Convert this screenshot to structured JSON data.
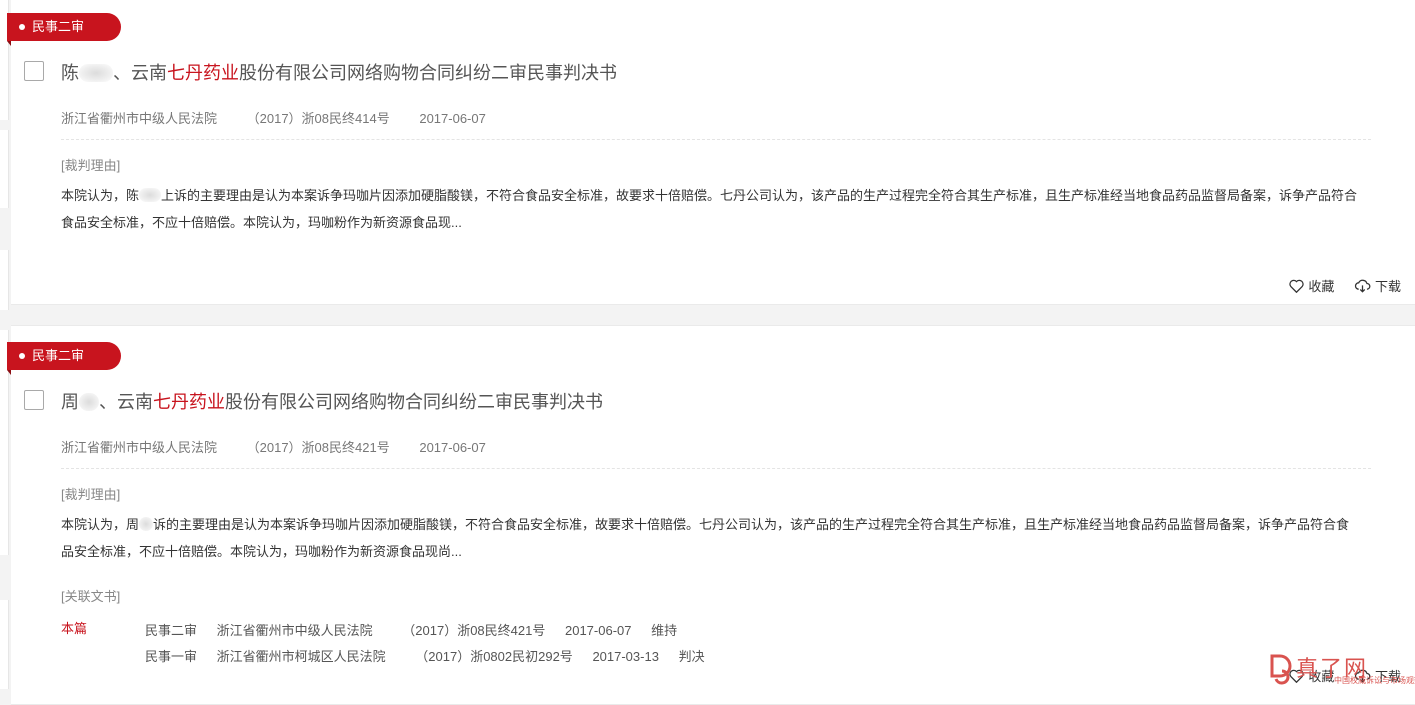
{
  "cases": [
    {
      "tag": "民事二审",
      "title": {
        "prefix": "陈",
        "middle": "、云南",
        "highlight": "七丹药业",
        "suffix": "股份有限公司网络购物合同纠纷二审民事判决书"
      },
      "court": "浙江省衢州市中级人民法院",
      "case_no": "（2017）浙08民终414号",
      "date": "2017-06-07",
      "reason_label": "[裁判理由]",
      "reason_a": "本院认为，陈",
      "reason_b": "上诉的主要理由是认为本案诉争玛咖片因添加硬脂酸镁，不符合食品安全标准，故要求十倍赔偿。七丹公司认为，该产品的生产过程完全符合其生产标准，且生产标准经当地食品药品监督局备案，诉争产品符合食品安全标准，不应十倍赔偿。本院认为，玛咖粉作为新资源食品现...",
      "actions": {
        "favorite": "收藏",
        "download": "下载"
      }
    },
    {
      "tag": "民事二审",
      "title": {
        "prefix": "周",
        "middle": "、云南",
        "highlight": "七丹药业",
        "suffix": "股份有限公司网络购物合同纠纷二审民事判决书"
      },
      "court": "浙江省衢州市中级人民法院",
      "case_no": "（2017）浙08民终421号",
      "date": "2017-06-07",
      "reason_label": "[裁判理由]",
      "reason_a": "本院认为，周",
      "reason_b": "诉的主要理由是认为本案诉争玛咖片因添加硬脂酸镁，不符合食品安全标准，故要求十倍赔偿。七丹公司认为，该产品的生产过程完全符合其生产标准，且生产标准经当地食品药品监督局备案，诉争产品符合食品安全标准，不应十倍赔偿。本院认为，玛咖粉作为新资源食品现尚...",
      "related_label": "[关联文书]",
      "current_label": "本篇",
      "related": [
        {
          "type": "民事二审",
          "court": "浙江省衢州市中级人民法院",
          "case_no": "（2017）浙08民终421号",
          "date": "2017-06-07",
          "result": "维持"
        },
        {
          "type": "民事一审",
          "court": "浙江省衢州市柯城区人民法院",
          "case_no": "（2017）浙0802民初292号",
          "date": "2017-03-13",
          "result": "判决"
        }
      ],
      "actions": {
        "favorite": "收藏",
        "download": "下载"
      }
    }
  ],
  "watermark": {
    "brand": "真了网",
    "subtitle": "中国权威诉讼与市场观察媒体"
  },
  "colors": {
    "accent": "#c8141e",
    "text": "#333333",
    "muted": "#777777"
  }
}
